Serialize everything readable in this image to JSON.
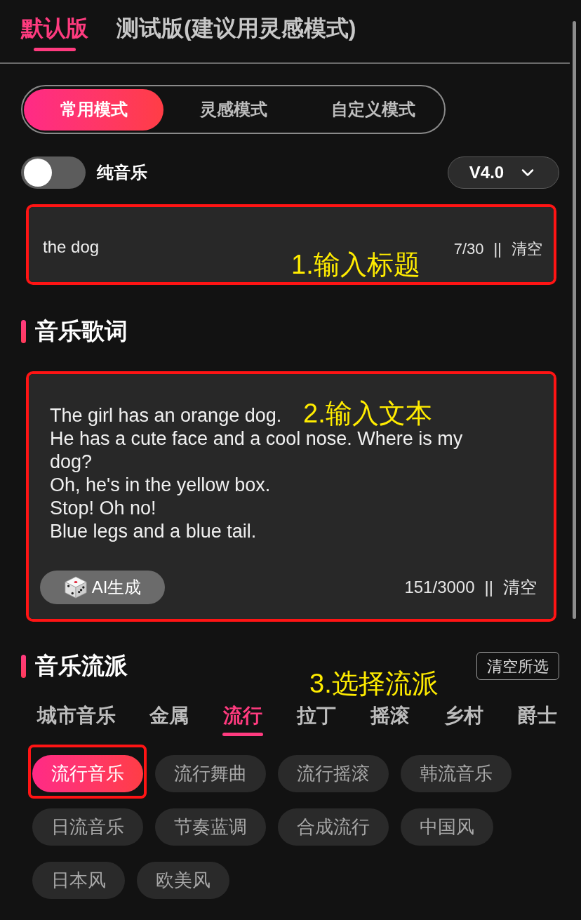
{
  "version_tabs": [
    {
      "label": "默认版",
      "selected": true
    },
    {
      "label": "测试版(建议用灵感模式)",
      "selected": false
    }
  ],
  "mode_tabs": [
    {
      "label": "常用模式",
      "selected": true
    },
    {
      "label": "灵感模式",
      "selected": false
    },
    {
      "label": "自定义模式",
      "selected": false
    }
  ],
  "instrumental_toggle": {
    "label": "纯音乐",
    "on": false
  },
  "model_select": {
    "value": "V4.0"
  },
  "title_field": {
    "value": "the dog",
    "counter": "7/30",
    "separator": "||",
    "clear": "清空",
    "annotation": "1.输入标题"
  },
  "lyrics": {
    "heading": "音乐歌词",
    "lines": [
      "The girl has an orange dog.",
      "He has a cute face and a cool nose. Where is my dog?",
      "Oh, he's in the yellow box.",
      "Stop! Oh no!",
      "Blue legs and a blue tail."
    ],
    "annotation": "2.输入文本",
    "ai_button": "AI生成",
    "counter": "151/3000",
    "separator": "||",
    "clear": "清空"
  },
  "genre": {
    "heading": "音乐流派",
    "clear_selection": "清空所选",
    "annotation": "3.选择流派",
    "categories": [
      {
        "label": "城市音乐",
        "selected": false
      },
      {
        "label": "金属",
        "selected": false
      },
      {
        "label": "流行",
        "selected": true
      },
      {
        "label": "拉丁",
        "selected": false
      },
      {
        "label": "摇滚",
        "selected": false
      },
      {
        "label": "乡村",
        "selected": false
      },
      {
        "label": "爵士",
        "selected": false
      }
    ],
    "styles": [
      {
        "label": "流行音乐",
        "selected": true
      },
      {
        "label": "流行舞曲",
        "selected": false
      },
      {
        "label": "流行摇滚",
        "selected": false
      },
      {
        "label": "韩流音乐",
        "selected": false
      },
      {
        "label": "日流音乐",
        "selected": false
      },
      {
        "label": "节奏蓝调",
        "selected": false
      },
      {
        "label": "合成流行",
        "selected": false
      },
      {
        "label": "中国风",
        "selected": false
      },
      {
        "label": "日本风",
        "selected": false
      },
      {
        "label": "欧美风",
        "selected": false
      }
    ]
  }
}
